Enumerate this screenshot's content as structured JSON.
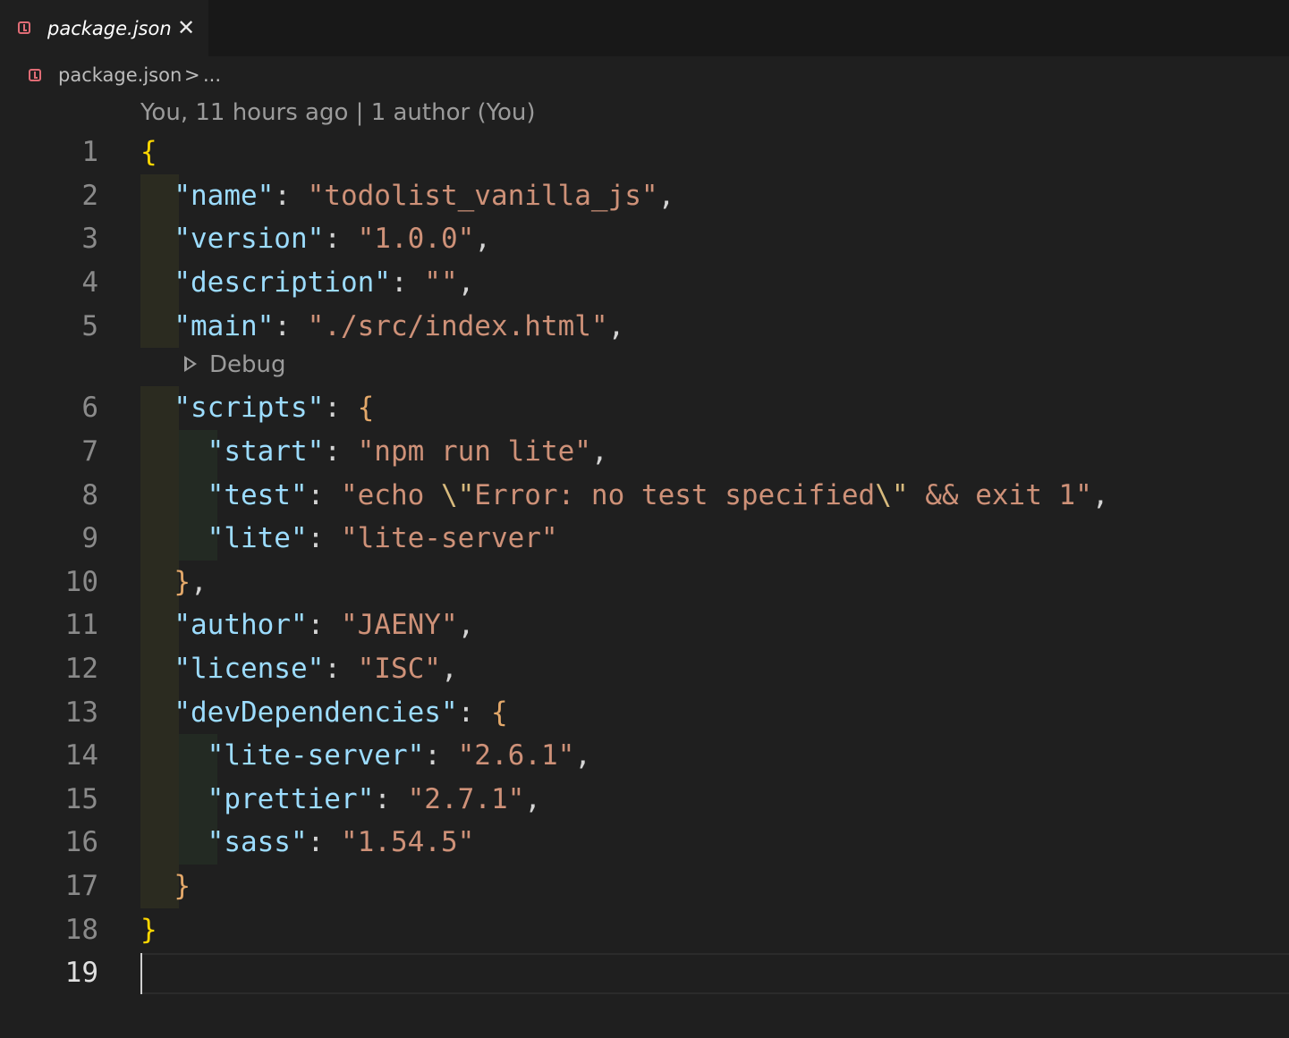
{
  "tab": {
    "file_icon": "json-file-icon",
    "label": "package.json",
    "close_icon": "close-icon",
    "close_glyph": "✕"
  },
  "breadcrumb": {
    "file_icon": "json-file-icon",
    "file": "package.json",
    "separator": ">",
    "ellipsis": "..."
  },
  "codelens": {
    "blame": "You, 11 hours ago | 1 author (You)",
    "debug": "Debug",
    "debug_icon": "play-icon"
  },
  "editor": {
    "cursor_line": 19,
    "lines": [
      {
        "number": "1",
        "tokens": [
          {
            "t": "{",
            "c": "b1"
          }
        ]
      },
      {
        "number": "2",
        "tokens": [
          {
            "t": "  ",
            "c": "p"
          },
          {
            "t": "\"name\"",
            "c": "k"
          },
          {
            "t": ": ",
            "c": "p"
          },
          {
            "t": "\"todolist_vanilla_js\"",
            "c": "s"
          },
          {
            "t": ",",
            "c": "p"
          }
        ]
      },
      {
        "number": "3",
        "tokens": [
          {
            "t": "  ",
            "c": "p"
          },
          {
            "t": "\"version\"",
            "c": "k"
          },
          {
            "t": ": ",
            "c": "p"
          },
          {
            "t": "\"1.0.0\"",
            "c": "s"
          },
          {
            "t": ",",
            "c": "p"
          }
        ]
      },
      {
        "number": "4",
        "tokens": [
          {
            "t": "  ",
            "c": "p"
          },
          {
            "t": "\"description\"",
            "c": "k"
          },
          {
            "t": ": ",
            "c": "p"
          },
          {
            "t": "\"\"",
            "c": "s"
          },
          {
            "t": ",",
            "c": "p"
          }
        ]
      },
      {
        "number": "5",
        "tokens": [
          {
            "t": "  ",
            "c": "p"
          },
          {
            "t": "\"main\"",
            "c": "k"
          },
          {
            "t": ": ",
            "c": "p"
          },
          {
            "t": "\"./src/index.html\"",
            "c": "s"
          },
          {
            "t": ",",
            "c": "p"
          }
        ]
      },
      {
        "number": "6",
        "tokens": [
          {
            "t": "  ",
            "c": "p"
          },
          {
            "t": "\"scripts\"",
            "c": "k"
          },
          {
            "t": ": ",
            "c": "p"
          },
          {
            "t": "{",
            "c": "b2o"
          }
        ]
      },
      {
        "number": "7",
        "tokens": [
          {
            "t": "    ",
            "c": "p"
          },
          {
            "t": "\"start\"",
            "c": "k"
          },
          {
            "t": ": ",
            "c": "p"
          },
          {
            "t": "\"npm run lite\"",
            "c": "s"
          },
          {
            "t": ",",
            "c": "p"
          }
        ]
      },
      {
        "number": "8",
        "tokens": [
          {
            "t": "    ",
            "c": "p"
          },
          {
            "t": "\"test\"",
            "c": "k"
          },
          {
            "t": ": ",
            "c": "p"
          },
          {
            "t": "\"echo ",
            "c": "s"
          },
          {
            "t": "\\\"",
            "c": "esc"
          },
          {
            "t": "Error: no test specified",
            "c": "s"
          },
          {
            "t": "\\\"",
            "c": "esc"
          },
          {
            "t": " && exit 1\"",
            "c": "s"
          },
          {
            "t": ",",
            "c": "p"
          }
        ]
      },
      {
        "number": "9",
        "tokens": [
          {
            "t": "    ",
            "c": "p"
          },
          {
            "t": "\"lite\"",
            "c": "k"
          },
          {
            "t": ": ",
            "c": "p"
          },
          {
            "t": "\"lite-server\"",
            "c": "s"
          }
        ]
      },
      {
        "number": "10",
        "tokens": [
          {
            "t": "  ",
            "c": "p"
          },
          {
            "t": "}",
            "c": "b2o"
          },
          {
            "t": ",",
            "c": "p"
          }
        ]
      },
      {
        "number": "11",
        "tokens": [
          {
            "t": "  ",
            "c": "p"
          },
          {
            "t": "\"author\"",
            "c": "k"
          },
          {
            "t": ": ",
            "c": "p"
          },
          {
            "t": "\"JAENY\"",
            "c": "s"
          },
          {
            "t": ",",
            "c": "p"
          }
        ]
      },
      {
        "number": "12",
        "tokens": [
          {
            "t": "  ",
            "c": "p"
          },
          {
            "t": "\"license\"",
            "c": "k"
          },
          {
            "t": ": ",
            "c": "p"
          },
          {
            "t": "\"ISC\"",
            "c": "s"
          },
          {
            "t": ",",
            "c": "p"
          }
        ]
      },
      {
        "number": "13",
        "tokens": [
          {
            "t": "  ",
            "c": "p"
          },
          {
            "t": "\"devDependencies\"",
            "c": "k"
          },
          {
            "t": ": ",
            "c": "p"
          },
          {
            "t": "{",
            "c": "b2o"
          }
        ]
      },
      {
        "number": "14",
        "tokens": [
          {
            "t": "    ",
            "c": "p"
          },
          {
            "t": "\"lite-server\"",
            "c": "k"
          },
          {
            "t": ": ",
            "c": "p"
          },
          {
            "t": "\"2.6.1\"",
            "c": "s"
          },
          {
            "t": ",",
            "c": "p"
          }
        ]
      },
      {
        "number": "15",
        "tokens": [
          {
            "t": "    ",
            "c": "p"
          },
          {
            "t": "\"prettier\"",
            "c": "k"
          },
          {
            "t": ": ",
            "c": "p"
          },
          {
            "t": "\"2.7.1\"",
            "c": "s"
          },
          {
            "t": ",",
            "c": "p"
          }
        ]
      },
      {
        "number": "16",
        "tokens": [
          {
            "t": "    ",
            "c": "p"
          },
          {
            "t": "\"sass\"",
            "c": "k"
          },
          {
            "t": ": ",
            "c": "p"
          },
          {
            "t": "\"1.54.5\"",
            "c": "s"
          }
        ]
      },
      {
        "number": "17",
        "tokens": [
          {
            "t": "  ",
            "c": "p"
          },
          {
            "t": "}",
            "c": "b2o"
          }
        ]
      },
      {
        "number": "18",
        "tokens": [
          {
            "t": "}",
            "c": "b1"
          }
        ]
      },
      {
        "number": "19",
        "tokens": []
      }
    ]
  },
  "colors": {
    "background": "#1f1f1f",
    "tab_bar": "#181818",
    "key": "#9cdcfe",
    "string": "#ce9178",
    "bracket_outer": "#ffd700",
    "bracket_inner": "#e3a86a",
    "json_icon": "#e06c75"
  }
}
